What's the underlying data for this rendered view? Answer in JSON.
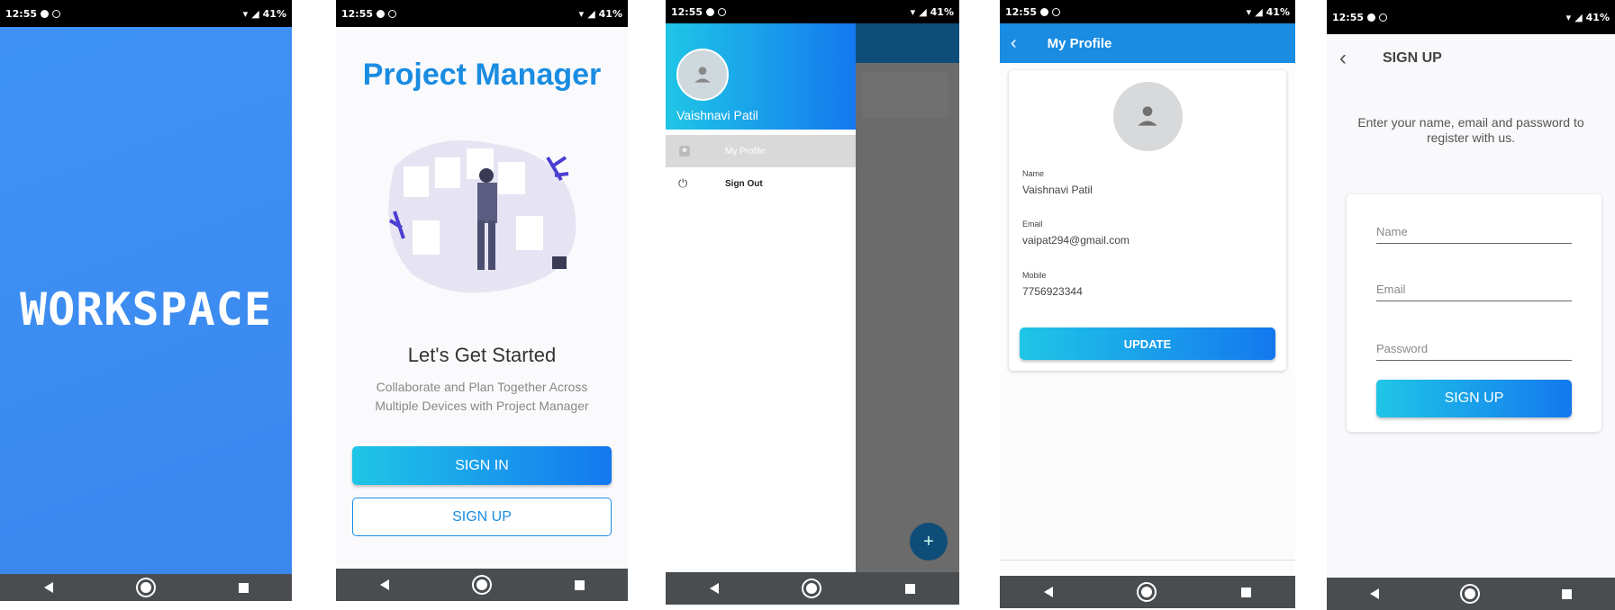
{
  "status": {
    "time": "12:55",
    "battery": "41%",
    "net": "4G"
  },
  "splash": {
    "title": "WORKSPACE"
  },
  "welcome": {
    "app_title": "Project Manager",
    "heading": "Let's Get Started",
    "subtitle_line1": "Collaborate and Plan Together Across",
    "subtitle_line2": "Multiple Devices with Project Manager",
    "signin_label": "SIGN IN",
    "signup_label": "SIGN UP"
  },
  "drawer": {
    "user_name": "Vaishnavi Patil",
    "items": [
      {
        "label": "My Profile",
        "icon": "person-icon"
      },
      {
        "label": "Sign Out",
        "icon": "power-icon"
      }
    ],
    "fab_label": "+"
  },
  "profile": {
    "title": "My Profile",
    "name_label": "Name",
    "name_value": "Vaishnavi Patil",
    "email_label": "Email",
    "email_value": "vaipat294@gmail.com",
    "mobile_label": "Mobile",
    "mobile_value": "7756923344",
    "update_label": "UPDATE"
  },
  "signup": {
    "title": "SIGN UP",
    "intro_line1": "Enter your name, email and password to",
    "intro_line2": "register with us.",
    "name_placeholder": "Name",
    "email_placeholder": "Email",
    "password_placeholder": "Password",
    "button_label": "SIGN UP"
  },
  "colors": {
    "primary": "#1a8ce2",
    "splash_bg": "#3d8ef2",
    "appbar": "#1a8ce2"
  }
}
